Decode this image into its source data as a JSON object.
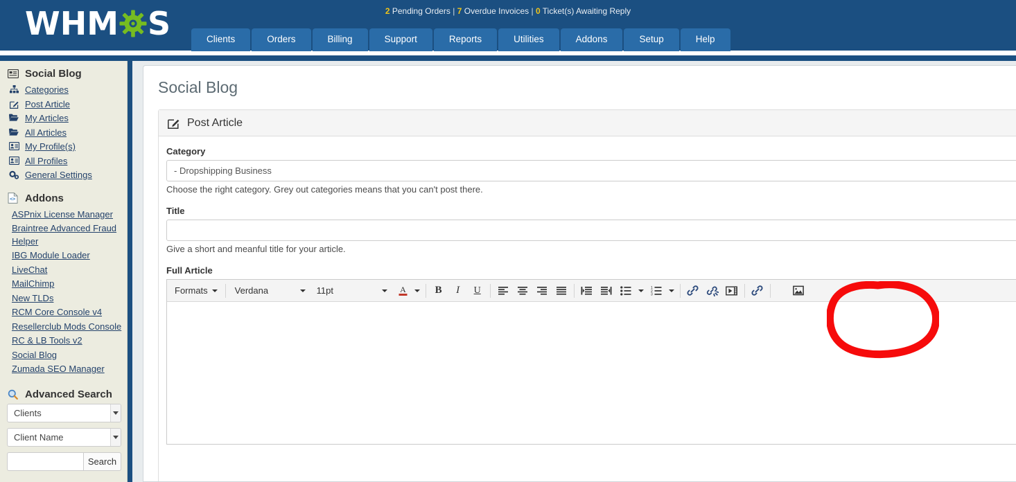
{
  "header": {
    "logo_text": "WHM",
    "logo_suffix": "S",
    "status": {
      "pending_count": "2",
      "pending_label": "Pending Orders",
      "overdue_count": "7",
      "overdue_label": "Overdue Invoices",
      "ticket_count": "0",
      "ticket_label": "Ticket(s) Awaiting Reply",
      "separator": "|"
    },
    "nav": [
      {
        "label": "Clients"
      },
      {
        "label": "Orders"
      },
      {
        "label": "Billing"
      },
      {
        "label": "Support"
      },
      {
        "label": "Reports"
      },
      {
        "label": "Utilities"
      },
      {
        "label": "Addons"
      },
      {
        "label": "Setup"
      },
      {
        "label": "Help"
      }
    ]
  },
  "sidebar": {
    "social_blog": {
      "title": "Social Blog",
      "icon": "card-list-icon",
      "items": [
        {
          "label": "Categories",
          "icon": "sitemap-icon"
        },
        {
          "label": "Post Article",
          "icon": "edit-square-icon"
        },
        {
          "label": "My Articles",
          "icon": "folder-open-icon"
        },
        {
          "label": "All Articles",
          "icon": "folder-open-icon"
        },
        {
          "label": "My Profile(s)",
          "icon": "id-card-icon"
        },
        {
          "label": "All Profiles",
          "icon": "id-card-icon"
        },
        {
          "label": "General Settings",
          "icon": "cogs-icon"
        }
      ]
    },
    "addons": {
      "title": "Addons",
      "icon": "code-file-icon",
      "items": [
        {
          "label": "ASPnix License Manager"
        },
        {
          "label": "Braintree Advanced Fraud Helper"
        },
        {
          "label": "IBG Module Loader"
        },
        {
          "label": "LiveChat"
        },
        {
          "label": "MailChimp"
        },
        {
          "label": "New TLDs"
        },
        {
          "label": "RCM Core Console v4"
        },
        {
          "label": "Resellerclub Mods Console"
        },
        {
          "label": "RC & LB Tools v2"
        },
        {
          "label": "Social Blog"
        },
        {
          "label": "Zumada SEO Manager"
        }
      ]
    },
    "advanced_search": {
      "title": "Advanced Search",
      "icon": "magnifier-icon",
      "type_value": "Clients",
      "field_value": "Client Name",
      "query_value": "",
      "query_placeholder": "",
      "button_label": "Search"
    }
  },
  "main": {
    "page_title": "Social Blog",
    "panel": {
      "heading": "Post Article",
      "heading_icon": "edit-square-icon",
      "category": {
        "label": "Category",
        "value": "  - Dropshipping Business",
        "help": "Choose the right category. Grey out categories means that you can't post there."
      },
      "title_field": {
        "label": "Title",
        "value": "",
        "placeholder": "",
        "help": "Give a short and meanful title for your article."
      },
      "article": {
        "label": "Full Article",
        "content": ""
      }
    }
  },
  "editor_toolbar": {
    "formats_label": "Formats",
    "font_family": "Verdana",
    "font_size": "11pt",
    "buttons": [
      {
        "name": "text-color-icon",
        "title": "Text color"
      },
      {
        "name": "bold-icon",
        "title": "Bold"
      },
      {
        "name": "italic-icon",
        "title": "Italic"
      },
      {
        "name": "underline-icon",
        "title": "Underline"
      },
      {
        "name": "align-left-icon",
        "title": "Align left"
      },
      {
        "name": "align-center-icon",
        "title": "Align center"
      },
      {
        "name": "align-right-icon",
        "title": "Align right"
      },
      {
        "name": "align-justify-icon",
        "title": "Justify"
      },
      {
        "name": "indent-icon",
        "title": "Increase indent"
      },
      {
        "name": "outdent-icon",
        "title": "Decrease indent"
      },
      {
        "name": "bullet-list-icon",
        "title": "Bullet list"
      },
      {
        "name": "numbered-list-icon",
        "title": "Numbered list"
      },
      {
        "name": "insert-link-icon",
        "title": "Insert/edit link"
      },
      {
        "name": "unlink-icon",
        "title": "Remove link"
      },
      {
        "name": "insert-video-icon",
        "title": "Insert/edit video"
      },
      {
        "name": "anchor-link-icon",
        "title": "Anchor"
      },
      {
        "name": "insert-image-icon",
        "title": "Insert/edit image"
      }
    ]
  },
  "annotation": {
    "type": "hand-drawn-ellipse",
    "color": "#f60b0b",
    "target": "insert-image-icon"
  }
}
